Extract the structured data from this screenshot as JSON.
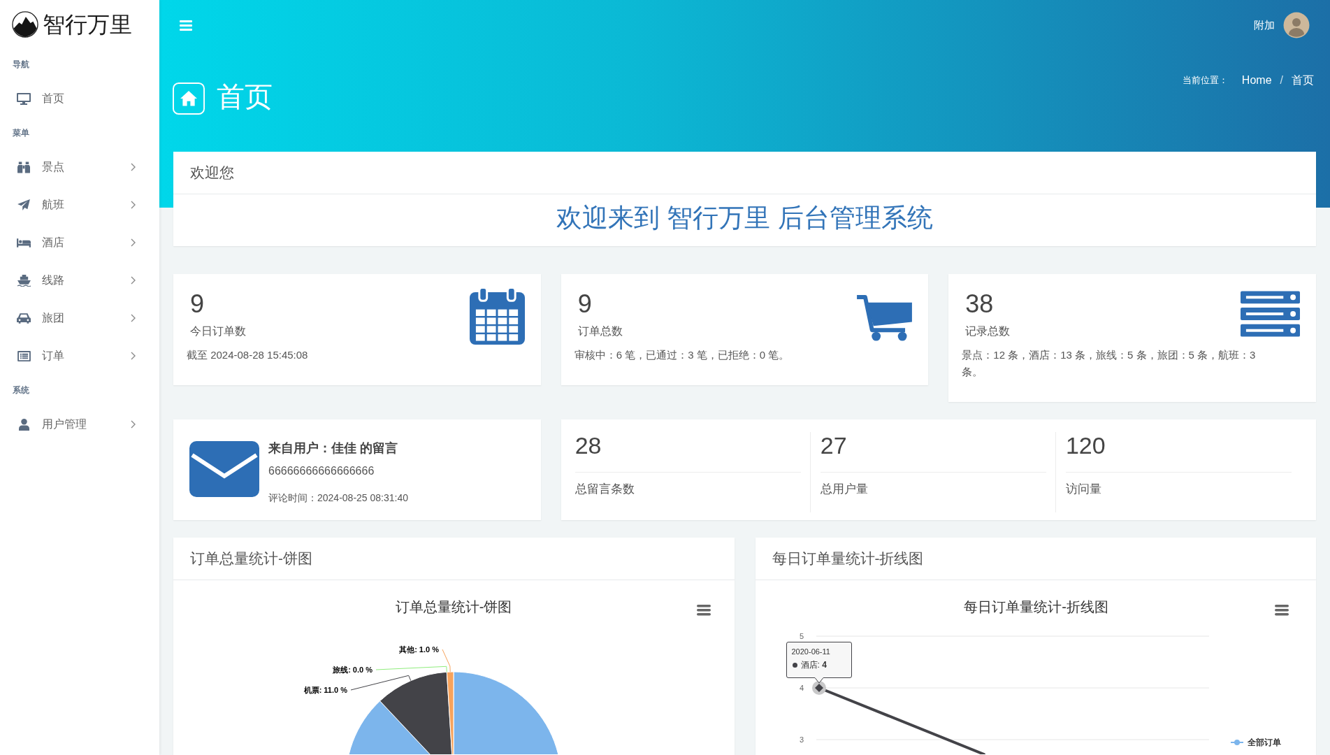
{
  "sidebar": {
    "brand": "智行万里",
    "sections": [
      {
        "label": "导航",
        "items": [
          {
            "label": "首页",
            "has_submenu": false
          }
        ]
      },
      {
        "label": "菜单",
        "items": [
          {
            "label": "景点",
            "has_submenu": true
          },
          {
            "label": "航班",
            "has_submenu": true
          },
          {
            "label": "酒店",
            "has_submenu": true
          },
          {
            "label": "线路",
            "has_submenu": true
          },
          {
            "label": "旅团",
            "has_submenu": true
          },
          {
            "label": "订单",
            "has_submenu": true
          }
        ]
      },
      {
        "label": "系统",
        "items": [
          {
            "label": "用户管理",
            "has_submenu": true
          }
        ]
      }
    ]
  },
  "topbar": {
    "user_name": "附加"
  },
  "page_header": {
    "title": "首页",
    "breadcrumb": {
      "label": "当前位置：",
      "items": [
        "Home",
        "首页"
      ],
      "separator": "/"
    }
  },
  "welcome": {
    "header": "欢迎您",
    "message": "欢迎来到 智行万里 后台管理系统"
  },
  "stat_cards": [
    {
      "value": "9",
      "label": "今日订单数",
      "detail": "截至 2024-08-28 15:45:08"
    },
    {
      "value": "9",
      "label": "订单总数",
      "detail": "审核中：6 笔，已通过：3 笔，已拒绝：0 笔。"
    },
    {
      "value": "38",
      "label": "记录总数",
      "detail": "景点：12 条，酒店：13 条，旅线：5 条，旅团：5 条，航班：3 条。"
    }
  ],
  "latest_message": {
    "title": "来自用户：佳佳 的留言",
    "body": "66666666666666666",
    "time": "评论时间：2024-08-25 08:31:40"
  },
  "totals": [
    {
      "value": "28",
      "label": "总留言条数"
    },
    {
      "value": "27",
      "label": "总用户量"
    },
    {
      "value": "120",
      "label": "访问量"
    }
  ],
  "pie_panel": {
    "header": "订单总量统计-饼图",
    "chart_data": {
      "type": "pie",
      "title": "订单总量统计-饼图",
      "values": [
        88,
        11,
        0,
        1
      ],
      "colors": [
        "#7cb5ec",
        "#434348",
        "#90ed7d",
        "#f7a35c"
      ],
      "value_labels": [
        null,
        "机票: 11.0 %",
        "旅线: 0.0 %",
        "其他: 1.0 %"
      ]
    }
  },
  "line_panel": {
    "header": "每日订单量统计-折线图",
    "chart": {
      "title": "每日订单量统计-折线图",
      "y_tick_labels": [
        "5",
        "4",
        "3"
      ],
      "tooltip": {
        "title": "2020-06-11",
        "rows": [
          "酒店: **4**"
        ]
      },
      "legend": [
        {
          "label": "全部订单",
          "color": "#7cb5ec"
        }
      ]
    }
  }
}
